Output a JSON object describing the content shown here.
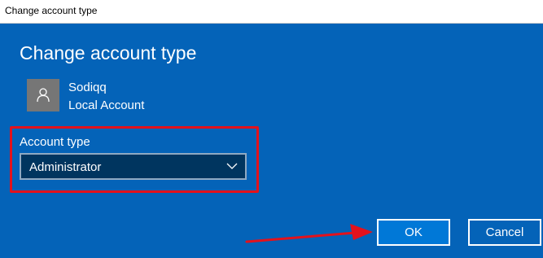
{
  "window": {
    "title": "Change account type"
  },
  "dialog": {
    "heading": "Change account type",
    "user": {
      "name": "Sodiqq",
      "account_kind": "Local Account",
      "avatar_icon": "person-icon"
    },
    "account_type": {
      "label": "Account type",
      "selected": "Administrator",
      "chevron_icon": "chevron-down-icon"
    },
    "buttons": {
      "ok": "OK",
      "cancel": "Cancel"
    }
  },
  "annotations": {
    "highlight_color": "#e3121c",
    "arrow_color": "#e3121c"
  },
  "colors": {
    "dialog_background": "#0463b8",
    "select_background": "#00355f",
    "ok_button": "#0078d7"
  }
}
